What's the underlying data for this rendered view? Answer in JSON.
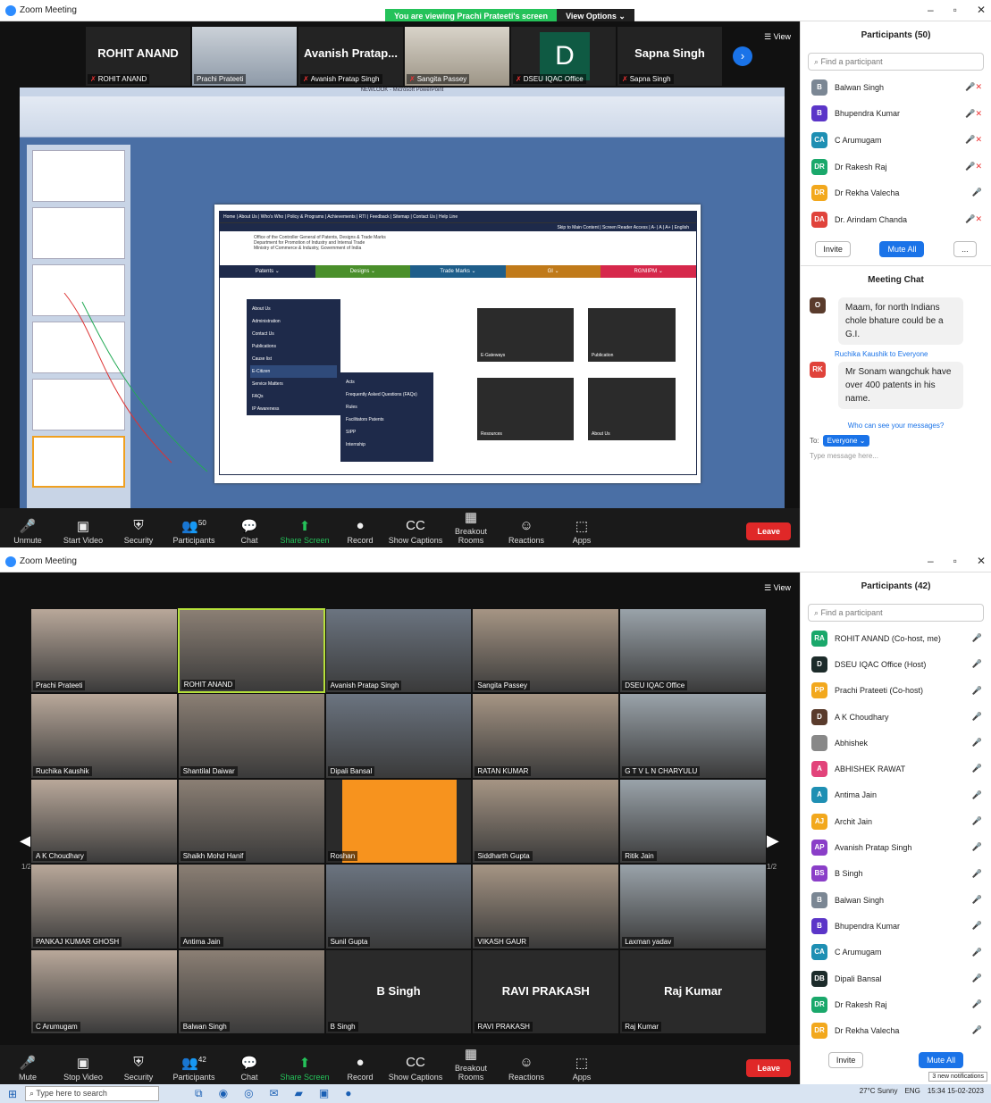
{
  "w1": {
    "title": "Zoom Meeting",
    "banner": "You are viewing Prachi Prateeti's screen",
    "view_options": "View Options ⌄",
    "view": "☰ View",
    "strip": [
      {
        "big": "ROHIT ANAND",
        "label": "ROHIT ANAND"
      },
      {
        "big": "",
        "label": "Prachi Prateeti"
      },
      {
        "big": "Avanish Pratap...",
        "label": "Avanish Pratap Singh"
      },
      {
        "big": "",
        "label": "Sangita Passey"
      },
      {
        "big": "D",
        "label": "DSEU IQAC Office"
      },
      {
        "big": "Sapna Singh",
        "label": "Sapna Singh"
      }
    ],
    "ppt_title": "NEWLOOK - Microsoft PowerPoint",
    "web": {
      "topnav": "Home | About Us | Who's Who | Policy & Programs | Achievements | RTI | Feedback | Sitemap | Contact Us | Help Line",
      "subnav": "Skip to Main Content | Screen Reader Access | A- | A | A+ | English",
      "office": "Office of the Controller General of Patents, Designs & Trade Marks",
      "dept": "Department for Promotion of Industry and Internal Trade",
      "ministry": "Ministry of Commerce & Industry, Government of India",
      "menu": [
        "Patents ⌄",
        "Designs ⌄",
        "Trade Marks ⌄",
        "GI ⌄",
        "RGNIIPM ⌄"
      ],
      "dd": [
        "About Us",
        "Administration",
        "Contact Us",
        "Publications",
        "Cause list",
        "E-Citizen",
        "Service Matters",
        "FAQs",
        "IP Awareness"
      ],
      "dd2": [
        "Acts",
        "Frequently Asked Questions (FAQs)",
        "Rules",
        "Facilitators Patents",
        "SIPP",
        "Internship"
      ],
      "cards": [
        "E-Gateways",
        "Publication",
        "Resources",
        "About Us"
      ]
    },
    "controls": [
      "Unmute",
      "Start Video",
      "Security",
      "Participants",
      "Chat",
      "Share Screen",
      "Record",
      "Show Captions",
      "Breakout Rooms",
      "Reactions",
      "Apps"
    ],
    "part_count": "50",
    "leave": "Leave",
    "panel_title": "Participants (50)",
    "search_placeholder": "Find a participant",
    "participants": [
      {
        "initials": "B",
        "name": "Balwan Singh",
        "color": "#7b8794"
      },
      {
        "initials": "B",
        "name": "Bhupendra Kumar",
        "color": "#5b35c8"
      },
      {
        "initials": "CA",
        "name": "C Arumugam",
        "color": "#1e8fb3"
      },
      {
        "initials": "DR",
        "name": "Dr Rakesh Raj",
        "color": "#1aa86b"
      },
      {
        "initials": "DR",
        "name": "Dr Rekha Valecha",
        "color": "#f2a81d"
      },
      {
        "initials": "DA",
        "name": "Dr. Arindam Chanda",
        "color": "#e0433b"
      }
    ],
    "invite": "Invite",
    "mute_all": "Mute All",
    "more": "...",
    "chat_title": "Meeting Chat",
    "msg1": "Maam, for north Indians chole bhature could be a G.I.",
    "sender2": "Ruchika Kaushik to Everyone",
    "msg2": "Mr Sonam wangchuk have over 400 patents in his name.",
    "who_see": "Who can see your messages?",
    "to": "To:",
    "to_target": "Everyone ⌄",
    "type_placeholder": "Type message here..."
  },
  "w2": {
    "title": "Zoom Meeting",
    "view": "☰ View",
    "tiles": [
      {
        "name": "Prachi Prateeti",
        "center": ""
      },
      {
        "name": "ROHIT ANAND",
        "center": ""
      },
      {
        "name": "Avanish Pratap Singh",
        "center": ""
      },
      {
        "name": "Sangita Passey",
        "center": ""
      },
      {
        "name": "DSEU IQAC Office",
        "center": ""
      },
      {
        "name": "Ruchika Kaushik",
        "center": ""
      },
      {
        "name": "Shantilal Daiwar",
        "center": ""
      },
      {
        "name": "Dipali Bansal",
        "center": ""
      },
      {
        "name": "RATAN KUMAR",
        "center": ""
      },
      {
        "name": "G T V L N CHARYULU",
        "center": ""
      },
      {
        "name": "A K Choudhary",
        "center": ""
      },
      {
        "name": "Shaikh Mohd Hanif",
        "center": ""
      },
      {
        "name": "Roshan",
        "center": ""
      },
      {
        "name": "Siddharth Gupta",
        "center": ""
      },
      {
        "name": "Ritik Jain",
        "center": ""
      },
      {
        "name": "PANKAJ KUMAR GHOSH",
        "center": ""
      },
      {
        "name": "Antima Jain",
        "center": ""
      },
      {
        "name": "Sunil Gupta",
        "center": ""
      },
      {
        "name": "VIKASH GAUR",
        "center": ""
      },
      {
        "name": "Laxman yadav",
        "center": ""
      },
      {
        "name": "C Arumugam",
        "center": ""
      },
      {
        "name": "Balwan Singh",
        "center": ""
      },
      {
        "name": "B Singh",
        "center": "B Singh"
      },
      {
        "name": "RAVI PRAKASH",
        "center": "RAVI PRAKASH"
      },
      {
        "name": "Raj Kumar",
        "center": "Raj Kumar"
      }
    ],
    "page": "1/2",
    "controls": [
      "Mute",
      "Stop Video",
      "Security",
      "Participants",
      "Chat",
      "Share Screen",
      "Record",
      "Show Captions",
      "Breakout Rooms",
      "Reactions",
      "Apps"
    ],
    "part_count": "42",
    "leave": "Leave",
    "panel_title": "Participants (42)",
    "search_placeholder": "Find a participant",
    "participants": [
      {
        "initials": "RA",
        "name": "ROHIT ANAND (Co-host, me)",
        "color": "#1aa86b"
      },
      {
        "initials": "D",
        "name": "DSEU IQAC Office (Host)",
        "color": "#1c2b2a"
      },
      {
        "initials": "PP",
        "name": "Prachi Prateeti (Co-host)",
        "color": "#f2a81d"
      },
      {
        "initials": "D",
        "name": "A K Choudhary",
        "color": "#5a3b2c"
      },
      {
        "initials": "",
        "name": "Abhishek",
        "color": "#888"
      },
      {
        "initials": "A",
        "name": "ABHISHEK RAWAT",
        "color": "#e2437a"
      },
      {
        "initials": "A",
        "name": "Antima Jain",
        "color": "#1e8fb3"
      },
      {
        "initials": "AJ",
        "name": "Archit Jain",
        "color": "#f2a81d"
      },
      {
        "initials": "AP",
        "name": "Avanish Pratap Singh",
        "color": "#8a3ec8"
      },
      {
        "initials": "BS",
        "name": "B Singh",
        "color": "#8a3ec8"
      },
      {
        "initials": "B",
        "name": "Balwan Singh",
        "color": "#7b8794"
      },
      {
        "initials": "B",
        "name": "Bhupendra Kumar",
        "color": "#5b35c8"
      },
      {
        "initials": "CA",
        "name": "C Arumugam",
        "color": "#1e8fb3"
      },
      {
        "initials": "DB",
        "name": "Dipali Bansal",
        "color": "#1c2b2a"
      },
      {
        "initials": "DR",
        "name": "Dr Rakesh Raj",
        "color": "#1aa86b"
      },
      {
        "initials": "DR",
        "name": "Dr Rekha Valecha",
        "color": "#f2a81d"
      }
    ],
    "invite": "Invite",
    "mute_all": "Mute All",
    "notif": "3 new notifications"
  },
  "taskbar": {
    "search": "Type here to search",
    "weather": "27°C Sunny",
    "lang": "ENG",
    "time": "15:34",
    "date": "15-02-2023"
  }
}
